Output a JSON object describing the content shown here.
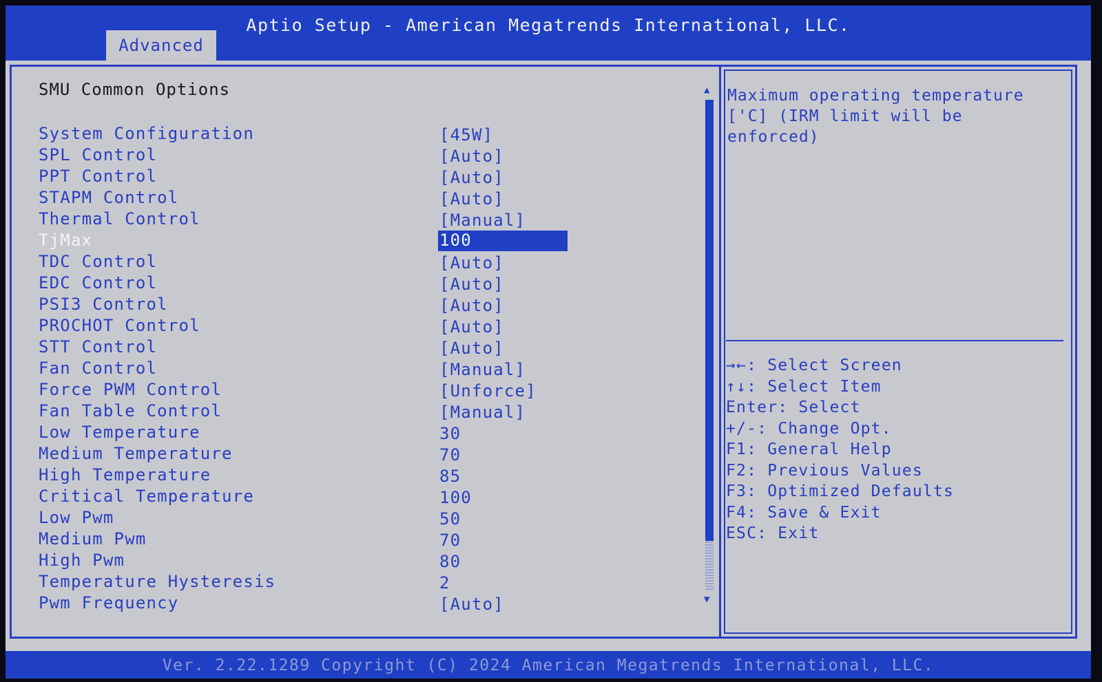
{
  "header": {
    "title": "Aptio Setup - American Megatrends International, LLC.",
    "tab_label": "Advanced"
  },
  "main": {
    "section_title": "SMU Common Options",
    "settings": [
      {
        "label": "System Configuration",
        "value": "[45W]"
      },
      {
        "label": "SPL Control",
        "value": "[Auto]"
      },
      {
        "label": "PPT Control",
        "value": "[Auto]"
      },
      {
        "label": "STAPM Control",
        "value": "[Auto]"
      },
      {
        "label": "Thermal Control",
        "value": "[Manual]"
      },
      {
        "label": "TjMax",
        "value": "100",
        "selected": true
      },
      {
        "label": "TDC Control",
        "value": "[Auto]"
      },
      {
        "label": "EDC Control",
        "value": "[Auto]"
      },
      {
        "label": "PSI3 Control",
        "value": "[Auto]"
      },
      {
        "label": "PROCHOT Control",
        "value": "[Auto]"
      },
      {
        "label": "STT Control",
        "value": "[Auto]"
      },
      {
        "label": "Fan Control",
        "value": "[Manual]"
      },
      {
        "label": "Force PWM Control",
        "value": "[Unforce]"
      },
      {
        "label": "Fan Table Control",
        "value": "[Manual]"
      },
      {
        "label": "Low Temperature",
        "value": "30"
      },
      {
        "label": "Medium Temperature",
        "value": "70"
      },
      {
        "label": "High Temperature",
        "value": "85"
      },
      {
        "label": "Critical Temperature",
        "value": "100"
      },
      {
        "label": "Low Pwm",
        "value": "50"
      },
      {
        "label": "Medium Pwm",
        "value": "70"
      },
      {
        "label": "High Pwm",
        "value": "80"
      },
      {
        "label": "Temperature Hysteresis",
        "value": "2"
      },
      {
        "label": "Pwm Frequency",
        "value": "[Auto]"
      }
    ]
  },
  "scrollbar": {
    "up_glyph": "▲",
    "down_glyph": "▼",
    "thumb_fraction": 0.9
  },
  "help": {
    "description": "Maximum operating temperature\n['C] (IRM limit will be\nenforced)",
    "keys": [
      "→←: Select Screen",
      "↑↓: Select Item",
      "Enter: Select",
      "+/-: Change Opt.",
      "F1: General Help",
      "F2: Previous Values",
      "F3: Optimized Defaults",
      "F4: Save & Exit",
      "ESC: Exit"
    ]
  },
  "footer": {
    "text": "Ver. 2.22.1289 Copyright (C) 2024 American Megatrends International, LLC."
  },
  "colors": {
    "accent_blue": "#1f3fc4",
    "text_blue": "#2a3ec0",
    "panel_gray": "#c7c9cf"
  }
}
